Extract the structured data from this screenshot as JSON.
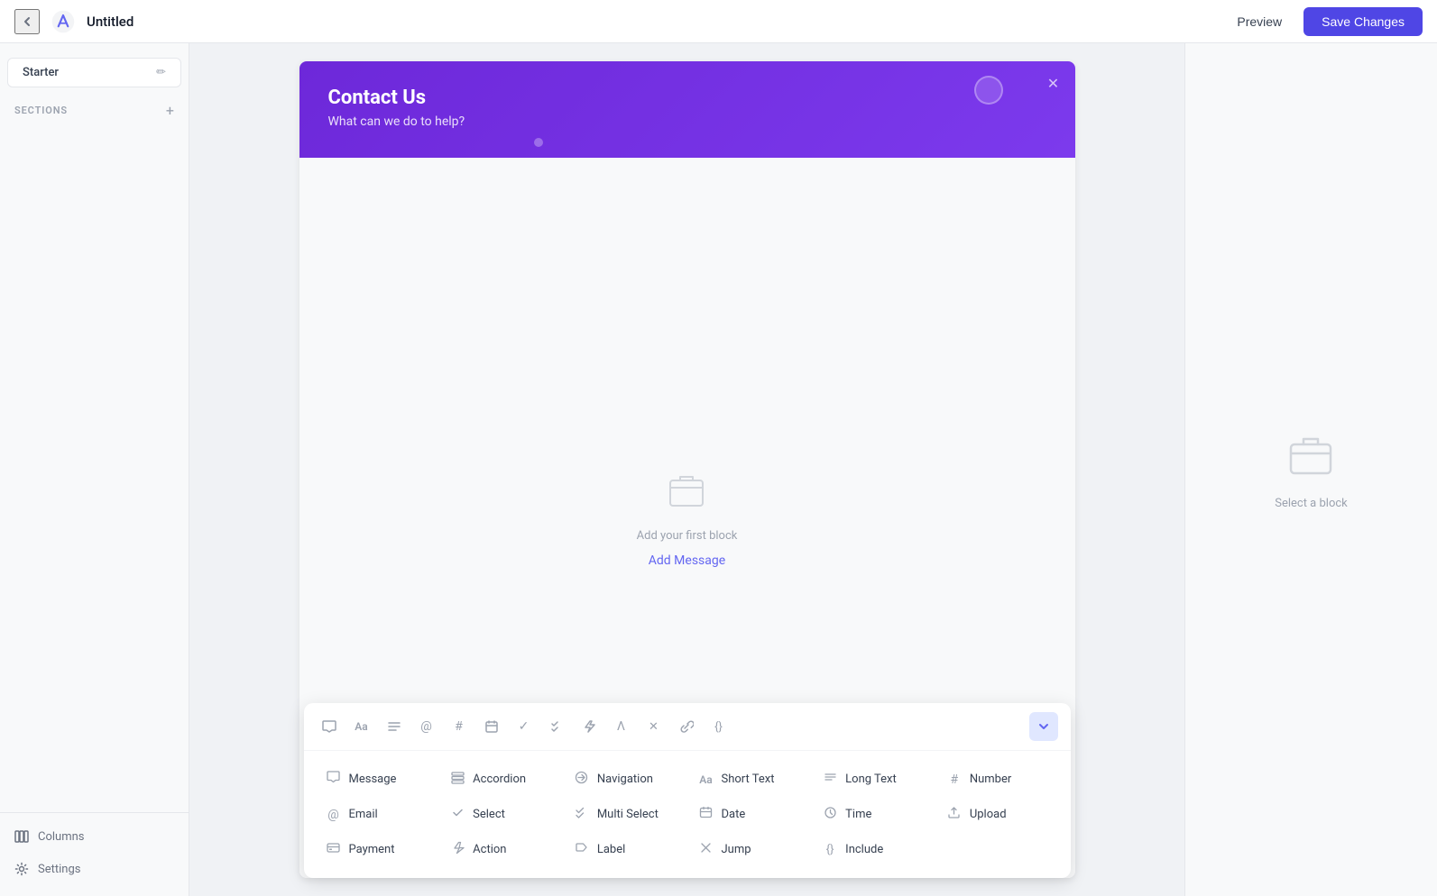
{
  "topbar": {
    "title": "Untitled",
    "preview_label": "Preview",
    "save_label": "Save Changes"
  },
  "sidebar": {
    "starter_label": "Starter",
    "sections_label": "SECTIONS",
    "nav_items": [
      {
        "id": "columns",
        "label": "Columns"
      },
      {
        "id": "settings",
        "label": "Settings"
      }
    ]
  },
  "form": {
    "header_title": "Contact Us",
    "header_subtitle": "What can we do to help?",
    "empty_text": "Add your first block",
    "add_message_label": "Add Message"
  },
  "block_picker": {
    "toolbar_icons": [
      {
        "name": "message-toolbar-icon",
        "glyph": "💬"
      },
      {
        "name": "text-toolbar-icon",
        "glyph": "Aa"
      },
      {
        "name": "align-toolbar-icon",
        "glyph": "≡"
      },
      {
        "name": "at-toolbar-icon",
        "glyph": "@"
      },
      {
        "name": "hash-toolbar-icon",
        "glyph": "#"
      },
      {
        "name": "calendar-toolbar-icon",
        "glyph": "▭"
      },
      {
        "name": "check-toolbar-icon",
        "glyph": "✓"
      },
      {
        "name": "multicheck-toolbar-icon",
        "glyph": "✓✓"
      },
      {
        "name": "lightning-toolbar-icon",
        "glyph": "⚡"
      },
      {
        "name": "lambda-toolbar-icon",
        "glyph": "Λ"
      },
      {
        "name": "cross-toolbar-icon",
        "glyph": "✕"
      },
      {
        "name": "link-toolbar-icon",
        "glyph": "⌗"
      },
      {
        "name": "code-toolbar-icon",
        "glyph": "{}"
      }
    ],
    "blocks": [
      {
        "id": "message",
        "label": "Message",
        "icon": "💬"
      },
      {
        "id": "accordion",
        "label": "Accordion",
        "icon": "☰"
      },
      {
        "id": "navigation",
        "label": "Navigation",
        "icon": "⛓"
      },
      {
        "id": "short-text",
        "label": "Short Text",
        "icon": "Aa"
      },
      {
        "id": "long-text",
        "label": "Long Text",
        "icon": "≡"
      },
      {
        "id": "number",
        "label": "Number",
        "icon": "#"
      },
      {
        "id": "email",
        "label": "Email",
        "icon": "@"
      },
      {
        "id": "select",
        "label": "Select",
        "icon": "✓"
      },
      {
        "id": "multi-select",
        "label": "Multi Select",
        "icon": "✓✓"
      },
      {
        "id": "date",
        "label": "Date",
        "icon": "▭"
      },
      {
        "id": "time",
        "label": "Time",
        "icon": "⏱"
      },
      {
        "id": "upload",
        "label": "Upload",
        "icon": "☁"
      },
      {
        "id": "payment",
        "label": "Payment",
        "icon": "💳"
      },
      {
        "id": "action",
        "label": "Action",
        "icon": "⚡"
      },
      {
        "id": "label",
        "label": "Label",
        "icon": "🏷"
      },
      {
        "id": "jump",
        "label": "Jump",
        "icon": "✕"
      },
      {
        "id": "include",
        "label": "Include",
        "icon": "{}"
      }
    ]
  },
  "right_panel": {
    "select_block_text": "Select a block"
  }
}
